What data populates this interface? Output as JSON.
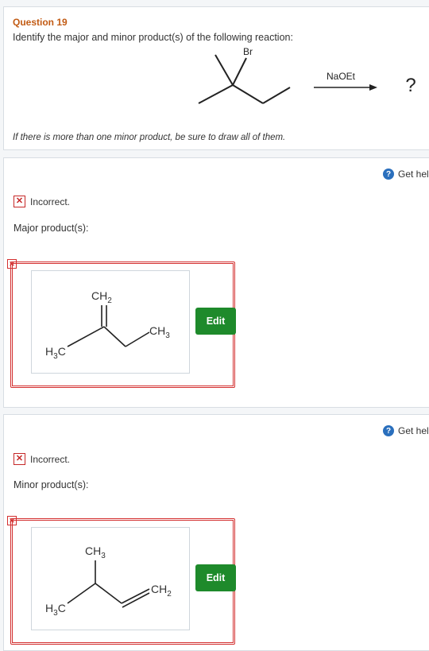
{
  "question": {
    "title": "Question 19",
    "prompt": "Identify the major and minor product(s) of the following reaction:",
    "reagent": "NaOEt",
    "substituent": "Br",
    "result": "?",
    "note": "If there is more than one minor product, be sure to draw all of them."
  },
  "help_label": "Get help",
  "major": {
    "status": "Incorrect.",
    "label": "Major product(s):",
    "edit_label": "Edit",
    "groups": {
      "top": "CH2",
      "right": "CH3",
      "left": "H3C"
    }
  },
  "minor": {
    "status": "Incorrect.",
    "label": "Minor product(s):",
    "edit_label": "Edit",
    "groups": {
      "top": "CH3",
      "right": "CH2",
      "left": "H3C"
    }
  },
  "colors": {
    "accent": "#c25b14",
    "error": "#d32f2f",
    "edit": "#1e8a2b",
    "help": "#2a6fbd"
  }
}
